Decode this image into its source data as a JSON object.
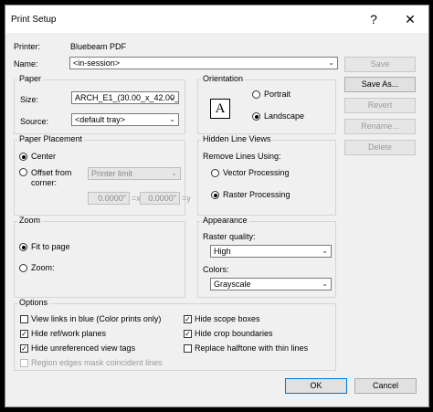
{
  "window": {
    "title": "Print Setup",
    "help_glyph": "?",
    "close_glyph": "✕"
  },
  "printer": {
    "label": "Printer:",
    "value": "Bluebeam PDF"
  },
  "name": {
    "label": "Name:",
    "value": "<in-session>"
  },
  "side_buttons": {
    "save": "Save",
    "save_as": "Save As...",
    "revert": "Revert",
    "rename": "Rename...",
    "delete": "Delete"
  },
  "paper": {
    "title": "Paper",
    "size_label": "Size:",
    "size_value": "ARCH_E1_(30.00_x_42.00_",
    "source_label": "Source:",
    "source_value": "<default tray>"
  },
  "orientation": {
    "title": "Orientation",
    "icon_glyph": "A",
    "portrait": "Portrait",
    "landscape": "Landscape",
    "selected": "landscape"
  },
  "placement": {
    "title": "Paper Placement",
    "center": "Center",
    "offset": "Offset from",
    "offset2": "corner:",
    "offset_combo": "Printer limit",
    "x_value": "0.0000\"",
    "x_suffix": "=x",
    "y_value": "0.0000\"",
    "y_suffix": "=y",
    "selected": "center"
  },
  "hidden": {
    "title": "Hidden Line Views",
    "remove_label": "Remove Lines Using:",
    "vector": "Vector Processing",
    "raster": "Raster Processing",
    "selected": "raster"
  },
  "zoom": {
    "title": "Zoom",
    "fit": "Fit to page",
    "zoom_label": "Zoom:",
    "selected": "fit"
  },
  "appearance": {
    "title": "Appearance",
    "quality_label": "Raster quality:",
    "quality_value": "High",
    "colors_label": "Colors:",
    "colors_value": "Grayscale"
  },
  "options": {
    "title": "Options",
    "items": [
      {
        "label": "View links in blue (Color prints only)",
        "checked": false,
        "disabled": false
      },
      {
        "label": "Hide ref/work planes",
        "checked": true,
        "disabled": false
      },
      {
        "label": "Hide unreferenced view tags",
        "checked": true,
        "disabled": false
      },
      {
        "label": "Region edges mask coincident lines",
        "checked": false,
        "disabled": true
      },
      {
        "label": "Hide scope boxes",
        "checked": true,
        "disabled": false
      },
      {
        "label": "Hide crop boundaries",
        "checked": true,
        "disabled": false
      },
      {
        "label": "Replace halftone with thin lines",
        "checked": false,
        "disabled": false
      }
    ]
  },
  "footer": {
    "ok": "OK",
    "cancel": "Cancel"
  },
  "glyphs": {
    "check": "✓",
    "arrow": "⌄"
  }
}
